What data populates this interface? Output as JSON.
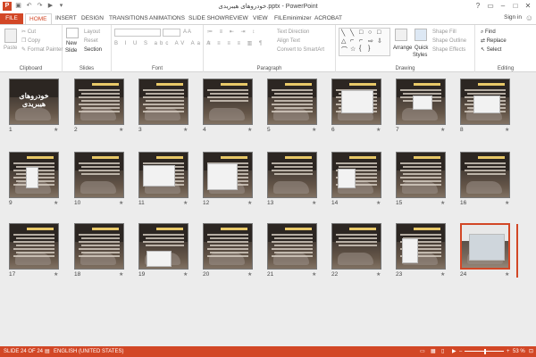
{
  "titlebar": {
    "title": "خودروهای هیبریدی.pptx - PowerPoint",
    "qat_icons": [
      "save-icon",
      "undo-icon",
      "redo-icon",
      "present-icon",
      "customize-icon"
    ],
    "controls": [
      "?",
      "▭",
      "–",
      "□",
      "✕"
    ]
  },
  "tabs": [
    "FILE",
    "HOME",
    "INSERT",
    "DESIGN",
    "TRANSITIONS",
    "ANIMATIONS",
    "SLIDE SHOW",
    "REVIEW",
    "VIEW",
    "FILEminimizer",
    "ACROBAT"
  ],
  "active_tab": "HOME",
  "signin": "Sign in",
  "ribbon": {
    "clipboard": {
      "label": "Clipboard",
      "paste": "Paste",
      "cut": "Cut",
      "copy": "Copy",
      "format_painter": "Format Painter"
    },
    "slides": {
      "label": "Slides",
      "new_slide": "New",
      "new_slide2": "Slide",
      "layout": "Layout",
      "reset": "Reset",
      "section": "Section"
    },
    "font": {
      "label": "Font"
    },
    "paragraph": {
      "label": "Paragraph",
      "text_direction": "Text Direction",
      "align_text": "Align Text",
      "smartart": "Convert to SmartArt"
    },
    "drawing": {
      "label": "Drawing",
      "arrange": "Arrange",
      "quick_styles": "Quick",
      "quick_styles2": "Styles",
      "shape_fill": "Shape Fill",
      "shape_outline": "Shape Outline",
      "shape_effects": "Shape Effects"
    },
    "editing": {
      "label": "Editing",
      "find": "Find",
      "replace": "Replace",
      "select": "Select"
    }
  },
  "slides": [
    {
      "n": "1"
    },
    {
      "n": "2"
    },
    {
      "n": "3"
    },
    {
      "n": "4"
    },
    {
      "n": "5"
    },
    {
      "n": "6"
    },
    {
      "n": "7"
    },
    {
      "n": "8"
    },
    {
      "n": "9"
    },
    {
      "n": "10"
    },
    {
      "n": "11"
    },
    {
      "n": "12"
    },
    {
      "n": "13"
    },
    {
      "n": "14"
    },
    {
      "n": "15"
    },
    {
      "n": "16"
    },
    {
      "n": "17"
    },
    {
      "n": "18"
    },
    {
      "n": "19"
    },
    {
      "n": "20"
    },
    {
      "n": "21"
    },
    {
      "n": "22"
    },
    {
      "n": "23"
    },
    {
      "n": "24"
    }
  ],
  "slide1_title": "خودروهای هیبریدی",
  "selected_slide": "24",
  "statusbar": {
    "slide_info": "SLIDE 24 OF 24",
    "language": "ENGLISH (UNITED STATES)",
    "zoom": "53 %",
    "zoom_level": 0.53
  },
  "colors": {
    "accent": "#d24726",
    "workspace": "#ececec"
  }
}
